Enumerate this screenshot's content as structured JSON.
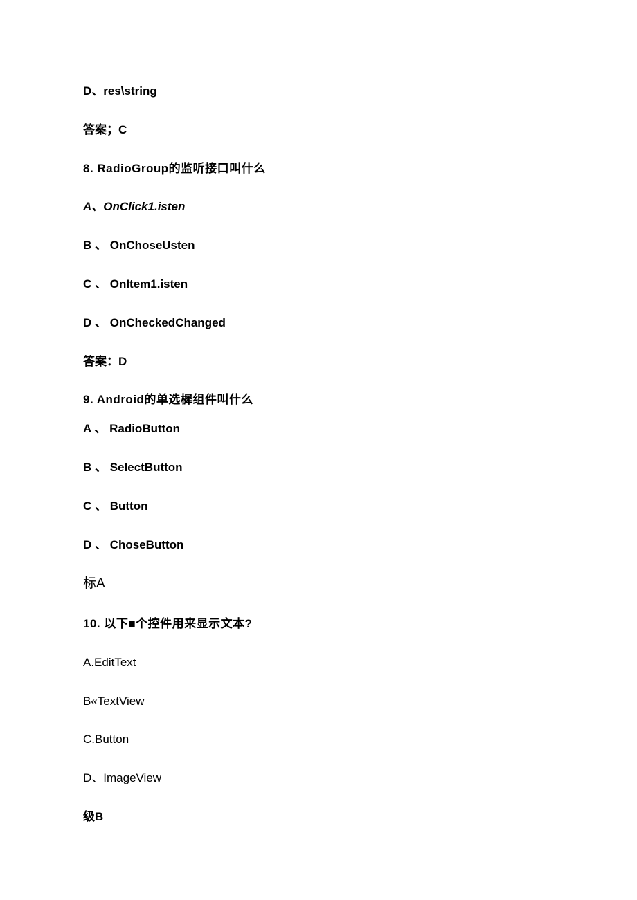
{
  "lines": [
    {
      "text": "D、res\\string",
      "bold": true
    },
    {
      "text": "答案；C",
      "bold": true
    },
    {
      "text": "8.   RadioGroup的监听接口叫什么",
      "bold": true
    },
    {
      "text": "A、OnClick1.isten",
      "bold": true,
      "italic": true
    },
    {
      "text": "B 、 OnChoseUsten",
      "bold": true
    },
    {
      "text": "C 、 OnItem1.isten",
      "bold": true
    },
    {
      "text": "D 、 OnCheckedChanged",
      "bold": true
    },
    {
      "text": "答案：D",
      "bold": true
    },
    {
      "text": "9.   Android的单选樨组件叫什么",
      "bold": true
    },
    {
      "text": "A 、 RadioButton",
      "bold": true,
      "close": true
    },
    {
      "text": "B 、 SelectButton",
      "bold": true
    },
    {
      "text": "C 、 Button",
      "bold": true
    },
    {
      "text": "D 、 ChoseButton",
      "bold": true
    },
    {
      "text": "标A",
      "bold": false,
      "large": true
    },
    {
      "text": "10.  以下■个控件用来显示文本?",
      "bold": true
    },
    {
      "text": "A.EditText",
      "bold": false
    },
    {
      "text": "B«TextView",
      "bold": false
    },
    {
      "text": "C.Button",
      "bold": false
    },
    {
      "text": "D、ImageView",
      "bold": false
    },
    {
      "text": "级B",
      "bold": true
    }
  ]
}
